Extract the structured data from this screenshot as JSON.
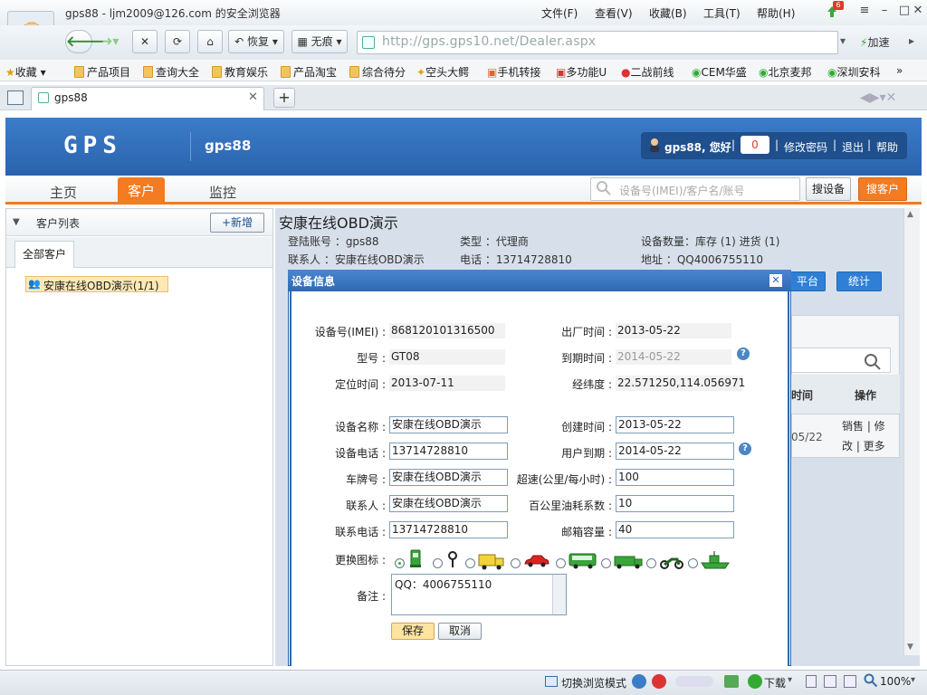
{
  "browser": {
    "window_title": "gps88 - ljm2009@126.com 的安全浏览器",
    "menu": [
      "文件(F)",
      "查看(V)",
      "收藏(B)",
      "工具(T)",
      "帮助(H)"
    ],
    "notify_count": "6",
    "back_label": "恢复",
    "trace_label": "无痕",
    "address": "http://gps.gps10.net/Dealer.aspx",
    "speedup_label": "加速",
    "bookmarks": [
      "收藏",
      "产品项目",
      "查询大全",
      "教育娱乐",
      "产品淘宝",
      "综合待分",
      "空头大鳄",
      "手机转接",
      "多功能U",
      "二战前线",
      "CEM华盛",
      "北京麦邦",
      "深圳安科"
    ],
    "tab_title": "gps88"
  },
  "app": {
    "logo": "GPS",
    "head_user": "gps88",
    "greeting": "gps88, 您好",
    "msg_count": "0",
    "links": [
      "修改密码",
      "退出",
      "帮助"
    ],
    "nav": [
      "主页",
      "客户",
      "监控"
    ],
    "search_placeholder": "设备号(IMEI)/客户名/账号",
    "search_device": "搜设备",
    "search_customer": "搜客户"
  },
  "left": {
    "title": "客户列表",
    "add_button": "+新增",
    "tab": "全部客户",
    "tree_item": "安康在线OBD演示(1/1)"
  },
  "customer": {
    "name": "安康在线OBD演示",
    "login_label": "登陆账号 ：gps88",
    "type_label": "类型 ：代理商",
    "device_count": "设备数量：库存 (1)  进货 (1)",
    "contact_label": "联系人 ：安康在线OBD演示",
    "phone_label": "电话 ：13714728810",
    "address_label": "地址 ：QQ4006755110",
    "btn_platform": "平台",
    "btn_stats": "统计",
    "col_time": "时间",
    "col_ops": "操作",
    "row_date": "05/22",
    "row_ops": "销售 | 修改 | 更多"
  },
  "dialog": {
    "title": "设备信息",
    "imei_label": "设备号(IMEI) :",
    "imei": "868120101316500",
    "model_label": "型号 :",
    "model": "GT08",
    "loc_time_label": "定位时间 :",
    "loc_time": "2013-07-11",
    "factory_label": "出厂时间 :",
    "factory": "2013-05-22",
    "expire_label": "到期时间 :",
    "expire": "2014-05-22",
    "latlng_label": "经纬度 :",
    "latlng": "22.571250,114.056971",
    "devname_label": "设备名称 :",
    "devname": "安康在线OBD演示",
    "devphone_label": "设备电话 :",
    "devphone": "13714728810",
    "plate_label": "车牌号 :",
    "plate": "安康在线OBD演示",
    "contact_label": "联系人 :",
    "contact": "安康在线OBD演示",
    "contactphone_label": "联系电话 :",
    "contactphone": "13714728810",
    "create_label": "创建时间 :",
    "create": "2013-05-22",
    "userexp_label": "用户到期 :",
    "userexp": "2014-05-22",
    "speed_label": "超速(公里/每小时) :",
    "speed": "100",
    "fuel_label": "百公里油耗系数 :",
    "fuel": "10",
    "mailbox_label": "邮箱容量 :",
    "mailbox": "40",
    "icon_label": "更换图标 :",
    "remark_label": "备注 :",
    "remark": "QQ：4006755110",
    "save": "保存",
    "cancel": "取消"
  },
  "status": {
    "mode": "切换浏览模式",
    "download": "下载",
    "zoom": "100%"
  },
  "colors": {
    "accent": "#f37b21",
    "header": "#2f68b2",
    "link": "#1a4c8c"
  }
}
